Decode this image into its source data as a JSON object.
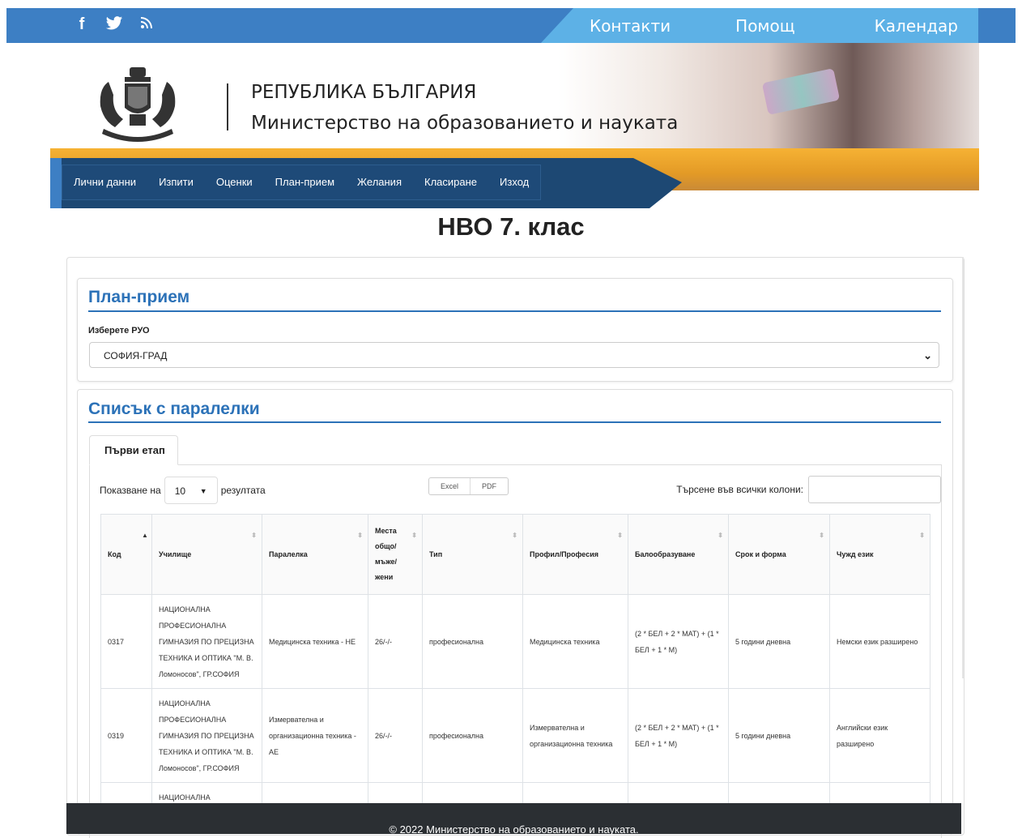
{
  "social": {
    "facebook": "f",
    "twitter": "🐦",
    "rss": "⟫"
  },
  "toplinks": [
    "Контакти",
    "Помощ",
    "Календар"
  ],
  "header": {
    "line1": "РЕПУБЛИКА БЪЛГАРИЯ",
    "line2": "Министерство на образованието и науката"
  },
  "nav": [
    "Лични данни",
    "Изпити",
    "Оценки",
    "План-прием",
    "Желания",
    "Класиране",
    "Изход"
  ],
  "page_title": "НВО 7. клас",
  "plan": {
    "heading": "План-прием",
    "select_label": "Изберете РУО",
    "select_value": "СОФИЯ-ГРАД"
  },
  "list": {
    "heading": "Списък с паралелки",
    "tab": "Първи етап",
    "show_prefix": "Показване на",
    "page_size": "10",
    "show_suffix": "резултата",
    "export": [
      "Excel",
      "PDF"
    ],
    "search_label": "Търсене във всички колони:",
    "columns": [
      "Код",
      "Училище",
      "Паралелка",
      "Места общо/ мъже/ жени",
      "Тип",
      "Профил/Професия",
      "Балообразуване",
      "Срок и форма",
      "Чужд език"
    ],
    "rows": [
      [
        "0317",
        "НАЦИОНАЛНА ПРОФЕСИОНАЛНА ГИМНАЗИЯ ПО ПРЕЦИЗНА ТЕХНИКА И ОПТИКА \"М. В. Ломоносов\", ГР.СОФИЯ",
        "Медицинска техника - НЕ",
        "26/-/-",
        "професионална",
        "Медицинска техника",
        "(2 * БЕЛ + 2 * МАТ) + (1 * БЕЛ + 1 * М)",
        "5 години дневна",
        "Немски език разширено"
      ],
      [
        "0319",
        "НАЦИОНАЛНА ПРОФЕСИОНАЛНА ГИМНАЗИЯ ПО ПРЕЦИЗНА ТЕХНИКА И ОПТИКА \"М. В. Ломоносов\", ГР.СОФИЯ",
        "Измервателна и организационна техника - АЕ",
        "26/-/-",
        "професионална",
        "Измервателна и организационна техника",
        "(2 * БЕЛ + 2 * МАТ) + (1 * БЕЛ + 1 * М)",
        "5 години дневна",
        "Английски език разширено"
      ],
      [
        "",
        "НАЦИОНАЛНА",
        "",
        "",
        "",
        "",
        "",
        "",
        ""
      ]
    ]
  },
  "footer": "© 2022 Министерство на образованието и науката."
}
